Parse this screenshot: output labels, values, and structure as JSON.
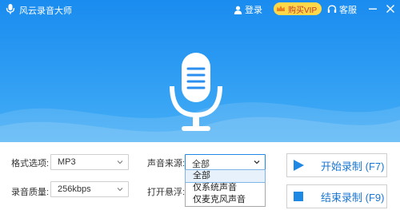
{
  "app": {
    "title": "风云录音大师"
  },
  "header": {
    "login_label": "登录",
    "vip_label": "购买VIP",
    "service_label": "客服"
  },
  "settings": {
    "format_label": "格式选项:",
    "format_value": "MP3",
    "source_label": "声音来源:",
    "source_value": "全部",
    "source_options": [
      "全部",
      "仅系统声音",
      "仅麦克风声音"
    ],
    "quality_label": "录音质量:",
    "quality_value": "256kbps",
    "float_label": "打开悬浮:"
  },
  "actions": {
    "start_label": "开始录制 (F7)",
    "stop_label": "结束录制 (F9)"
  },
  "colors": {
    "accent": "#1e88e5",
    "hero_top": "#1a8cf0",
    "vip_bg": "#ffd84a"
  }
}
